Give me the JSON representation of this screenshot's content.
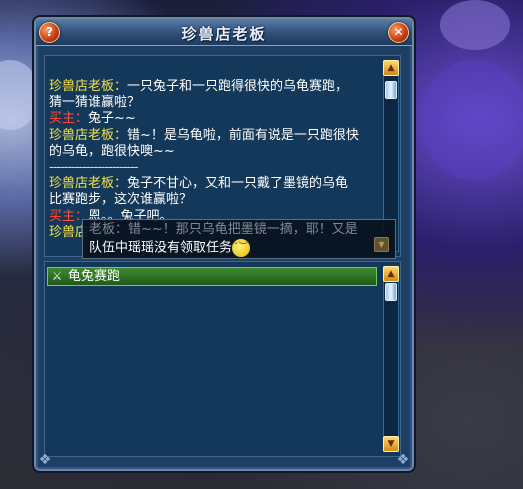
{
  "window": {
    "title": "珍兽店老板",
    "help_label": "?",
    "close_label": "✕"
  },
  "chat": {
    "lines": [
      {
        "speaker": "珍兽店老板：",
        "role": "boss",
        "text": "一只兔子和一只跑得很快的乌龟赛跑，"
      },
      {
        "speaker": "",
        "role": "boss",
        "text": "猜一猜谁赢啦？"
      },
      {
        "speaker": "买主：",
        "role": "buyer",
        "text": "兔子~~"
      },
      {
        "speaker": "珍兽店老板：",
        "role": "boss",
        "text": "错~！是乌龟啦，前面有说是一只跑很快"
      },
      {
        "speaker": "",
        "role": "boss",
        "text": "的乌龟，跑很快噢~~"
      },
      {
        "speaker": "",
        "role": "divider",
        "text": "------------------------"
      },
      {
        "speaker": "珍兽店老板：",
        "role": "boss",
        "text": "兔子不甘心，又和一只戴了墨镜的乌龟"
      },
      {
        "speaker": "",
        "role": "boss",
        "text": "比赛跑步，这次谁赢啦？"
      },
      {
        "speaker": "买主：",
        "role": "buyer",
        "text": "恩。。兔子吧。"
      },
      {
        "speaker": "珍兽店",
        "role": "boss",
        "text": ""
      }
    ]
  },
  "tooltip": {
    "faded_text": "老板：错~~！那只乌龟把墨镜一摘，耶！又是",
    "text": "队伍中瑶瑶没有领取任务",
    "emoji": "emoji-face"
  },
  "tasks": {
    "items": [
      {
        "label": "龟兔赛跑",
        "icon": "crossed-swords-icon"
      }
    ]
  }
}
